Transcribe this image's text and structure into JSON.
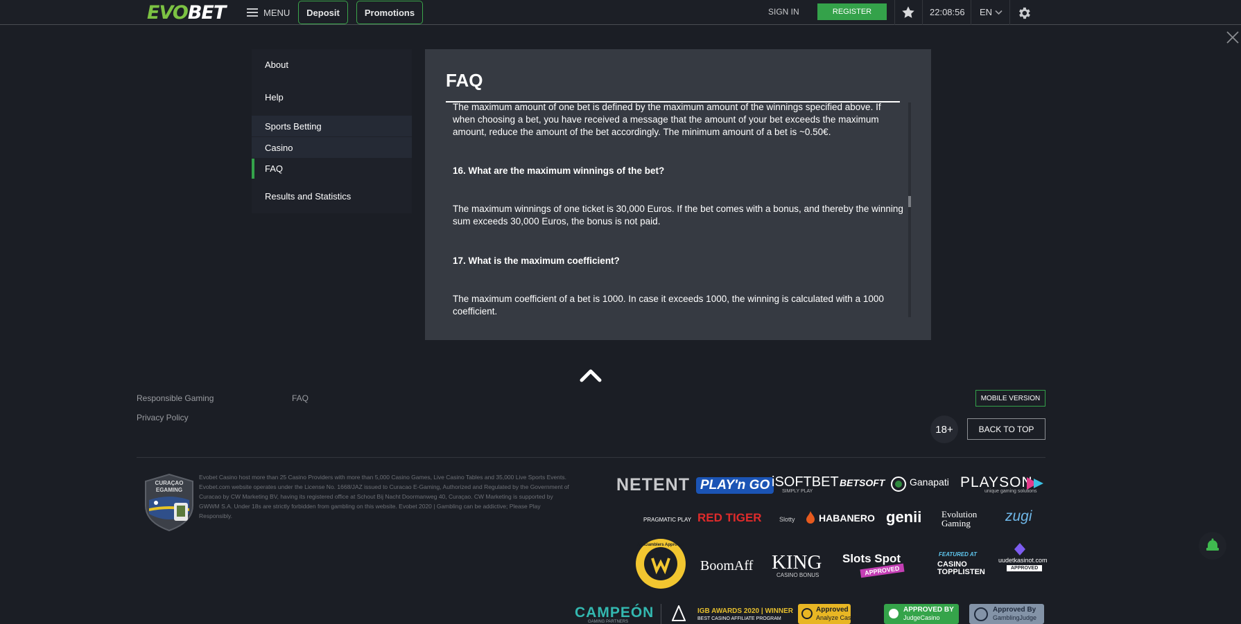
{
  "header": {
    "logo_prefix": "EVO",
    "logo_suffix": "BET",
    "menu_label": "MENU",
    "deposit_label": "Deposit",
    "promotions_label": "Promotions",
    "signin_label": "SIGN IN",
    "register_label": "REGISTER",
    "clock": "22:08:56",
    "language": "EN"
  },
  "sidebar": {
    "items": [
      {
        "label": "About"
      },
      {
        "label": "Help"
      },
      {
        "label": "Sports Betting"
      },
      {
        "label": "Casino"
      },
      {
        "label": "FAQ"
      },
      {
        "label": "Results and Statistics"
      }
    ],
    "active": "FAQ"
  },
  "faq": {
    "title": "FAQ",
    "paragraphs": [
      "The maximum amount of one bet is defined by the maximum amount of the winnings specified above. If when choosing a bet, you have received a message that the amount of your bet exceeds the maximum amount, reduce the amount of the bet accordingly. The minimum amount of a bet is ~0.50€.",
      "16. What are the maximum winnings of the bet?",
      "The maximum winnings of one ticket is 30,000 Euros. If the bet comes with a bonus, and thereby the winning sum exceeds 30,000 Euros, the bonus is not paid.",
      "17. What is the maximum coefficient?",
      "The maximum coefficient of a bet is 1000. In case it exceeds 1000, the winning is calculated with a 1000 coefficient."
    ]
  },
  "footer": {
    "links": [
      "Responsible Gaming",
      "FAQ",
      "Privacy Policy"
    ],
    "mobile_version_label": "MOBILE VERSION",
    "age_label": "18+",
    "back_to_top_label": "BACK TO TOP",
    "curacao_label_1": "CURAÇAO",
    "curacao_label_2": "EGAMING",
    "legal_text": "Evobet Casino host more than 25 Casino Providers with more than 5,000 Casino Games, Live Casino Tables and 35,000 Live Sports Events. Evobet.com website operates under the License No. 1668/JAZ issued to Curacao E-Gaming, Authorized and Regulated by the Government of Curacao by CW Marketing BV, having its registered office at Schout Bij Nacht Doormanweg 40, Curaçao. CW Marketing is supported by GWWM S.A. Under 18s are strictly forbidden from gambling on this website. Evobet 2020 | Gambling can be addictive; Please Play Responsibly.",
    "providers_row1": [
      "NETENT",
      "PLAY'n GO",
      "iSOFTBET",
      "BETSOFT",
      "Ganapati",
      "PLAYSON"
    ],
    "providers_row1_sub": {
      "isoftbet": "SIMPLY PLAY",
      "playson": "unique gaming solutions"
    },
    "providers_row2": [
      "PRAGMATIC PLAY",
      "RED TIGER",
      "Slotty",
      "HABANERO",
      "genii",
      "Evolution Gaming",
      "zugi"
    ],
    "badges_row3": [
      "AskGamblers Approved",
      "BoomAff",
      "KING",
      "CASINO BONUS",
      "Slots Spot",
      "APPROVED",
      "FEATURED AT",
      "CASINO TOPPLISTEN",
      "uudetkasinot.com",
      "APPROVED"
    ],
    "badges_row4": [
      "CAMPEÓN",
      "GAMING PARTNERS",
      "IGB AWARDS 2020 | WINNER",
      "BEST CASINO AFFILIATE PROGRAM",
      "Approved By",
      "Analyze Casino",
      "APPROVED BY",
      "JudgeCasino",
      "Approved By",
      "GamblingJudge"
    ]
  },
  "colors": {
    "brand_green": "#34a24a",
    "logo_green": "#7cc243",
    "background": "#1b1e25",
    "panel": "#363a42"
  },
  "icons": [
    "menu-icon",
    "star-icon",
    "chevron-down-icon",
    "gear-icon",
    "close-icon",
    "chevron-up-icon",
    "bell-icon"
  ]
}
